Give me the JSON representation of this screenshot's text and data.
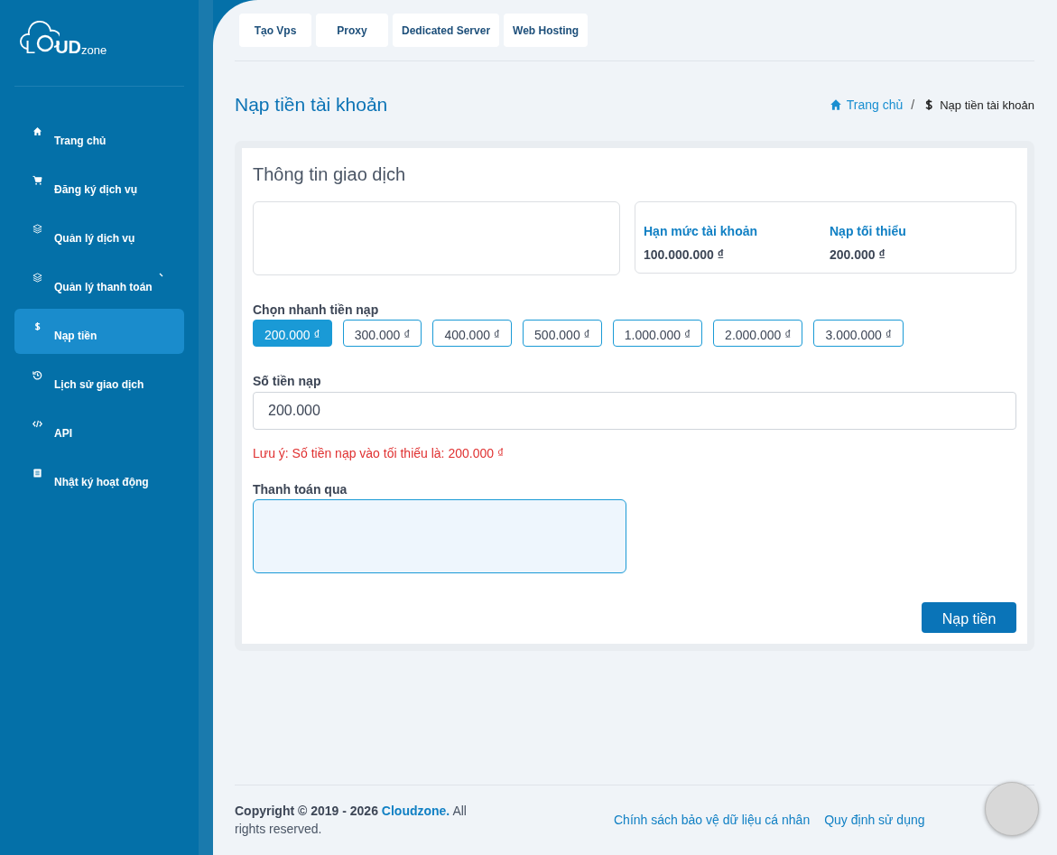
{
  "logo": {
    "letter": "L",
    "main": "UD",
    "suffix": "zone"
  },
  "sidebar": {
    "items": [
      {
        "label": "Trang chủ",
        "selected": false,
        "expandable": false
      },
      {
        "label": "Đăng ký dịch vụ",
        "selected": false,
        "expandable": false
      },
      {
        "label": "Quản lý dịch vụ",
        "selected": false,
        "expandable": false
      },
      {
        "label": "Quản lý thanh toán",
        "selected": false,
        "expandable": true
      },
      {
        "label": "Nạp tiền",
        "selected": true,
        "expandable": false
      },
      {
        "label": "Lịch sử giao dịch",
        "selected": false,
        "expandable": false
      },
      {
        "label": "API",
        "selected": false,
        "expandable": false
      },
      {
        "label": "Nhật ký hoạt động",
        "selected": false,
        "expandable": false
      }
    ]
  },
  "top_tabs": [
    "Tạo Vps",
    "Proxy",
    "Dedicated Server",
    "Web Hosting"
  ],
  "page_title": "Nạp tiền tài khoản",
  "breadcrumb": {
    "home": "Trang chủ",
    "separator": "/",
    "current": "Nạp tiền tài khoản"
  },
  "card": {
    "title": "Thông tin giao dịch",
    "limits": [
      {
        "label": "Hạn mức tài khoản",
        "value": "100.000.000 ₫"
      },
      {
        "label": "Nạp tối thiểu",
        "value": "200.000 ₫"
      }
    ],
    "quick_label": "Chọn nhanh tiền nạp",
    "quick_amounts": [
      {
        "label": "200.000 ₫",
        "selected": true
      },
      {
        "label": "300.000 ₫",
        "selected": false
      },
      {
        "label": "400.000 ₫",
        "selected": false
      },
      {
        "label": "500.000 ₫",
        "selected": false
      },
      {
        "label": "1.000.000 ₫",
        "selected": false
      },
      {
        "label": "2.000.000 ₫",
        "selected": false
      },
      {
        "label": "3.000.000 ₫",
        "selected": false
      }
    ],
    "amount_label": "Số tiền nạp",
    "amount_value": "200.000",
    "note": "Lưu ý: Số tiền nạp vào tối thiểu là: 200.000 ₫",
    "payment_label": "Thanh toán qua",
    "submit": "Nạp tiền"
  },
  "footer": {
    "copyright": "Copyright © 2019 - 2026",
    "brand": "Cloudzone.",
    "rights": "All rights reserved.",
    "links": [
      "Chính sách bảo vệ dữ liệu cá nhân",
      "Quy định sử dụng"
    ]
  }
}
